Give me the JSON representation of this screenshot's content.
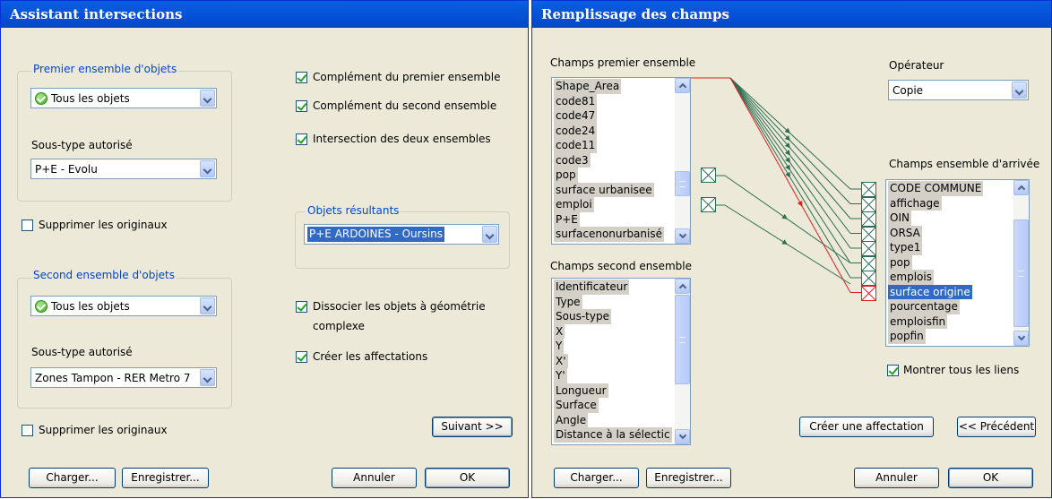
{
  "left_window": {
    "title": "Assistant intersections",
    "first_group": {
      "legend": "Premier ensemble d'objets",
      "object_select": "Tous les objets",
      "subtype_label": "Sous-type autorisé",
      "subtype_select": "P+E - Evolu"
    },
    "delete_originals_1": "Supprimer les originaux",
    "second_group": {
      "legend": "Second ensemble d'objets",
      "object_select": "Tous les objets",
      "subtype_label": "Sous-type autorisé",
      "subtype_select": "Zones Tampon - RER Metro 7"
    },
    "delete_originals_2": "Supprimer les originaux",
    "options": [
      {
        "label": "Complément du premier ensemble",
        "checked": true
      },
      {
        "label": "Complément du second ensemble",
        "checked": true
      },
      {
        "label": "Intersection des deux ensembles",
        "checked": true
      }
    ],
    "result_group": {
      "legend": "Objets résultants",
      "select": "P+E ARDOINES - Oursins"
    },
    "dissociate_label_1": "Dissocier les objets à géométrie",
    "dissociate_label_2": "complexe",
    "create_assignments": "Créer les affectations",
    "next_button": "Suivant >>",
    "load_button": "Charger...",
    "save_button": "Enregistrer...",
    "cancel_button": "Annuler",
    "ok_button": "OK"
  },
  "right_window": {
    "title": "Remplissage des champs",
    "first_fields_label": "Champs premier ensemble",
    "first_fields": [
      "Shape_Area",
      "code81",
      "code47",
      "code24",
      "code11",
      "code3",
      "pop",
      "surface urbanisee",
      "emploi",
      "P+E",
      "surfacenonurbanisé"
    ],
    "operator_label": "Opérateur",
    "operator_select": "Copie",
    "second_fields_label": "Champs second ensemble",
    "second_fields": [
      "Identificateur",
      "Type",
      "Sous-type",
      "X",
      "Y",
      "X'",
      "Y'",
      "Longueur",
      "Surface",
      "Angle",
      "Distance à la sélectic"
    ],
    "target_fields_label": "Champs ensemble d'arrivée",
    "target_fields": [
      "CODE COMMUNE",
      "affichage",
      "OIN",
      "ORSA",
      "type1",
      "pop",
      "emplois",
      "surface origine",
      "pourcentage",
      "emploisfin",
      "popfin"
    ],
    "selected_target": "surface origine",
    "show_all_links": "Montrer tous les liens",
    "create_assignment_button": "Créer une affectation",
    "previous_button": "<< Précédent",
    "load_button": "Charger...",
    "save_button": "Enregistrer...",
    "cancel_button": "Annuler",
    "ok_button": "OK"
  },
  "colors": {
    "title_bar": "#0553d9",
    "link_line": "#2e6e52",
    "selected_link": "#e02020",
    "selection": "#316ac5"
  }
}
